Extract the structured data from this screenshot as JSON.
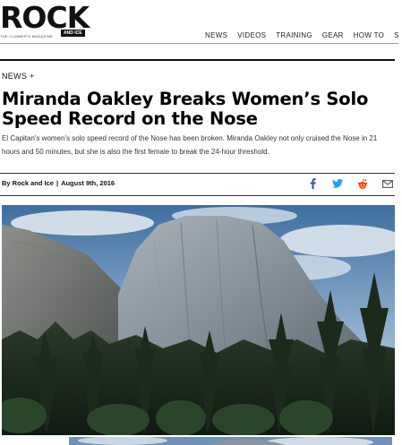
{
  "site": {
    "logo_text": "ROCK",
    "logo_badge": "AND ICE",
    "tagline": "THE CLIMBER'S MAGAZINE",
    "nav": [
      "NEWS",
      "VIDEOS",
      "TRAINING",
      "GEAR",
      "HOW TO",
      "S"
    ]
  },
  "article": {
    "category": "NEWS +",
    "title": "Miranda Oakley Breaks Women’s Solo Speed Record on the Nose",
    "dek": "El Capitan's women's solo speed record of the Nose has been broken. Miranda Oakley not only cruised the Nose in 21 hours and 50 minutes, but she is also the first female to break the 24-hour threshold.",
    "author": "By Rock and Ice",
    "date": "August 9th, 2016",
    "separator": "|"
  },
  "share": {
    "icons": [
      "facebook-icon",
      "twitter-icon",
      "reddit-icon",
      "email-icon"
    ]
  },
  "colors": {
    "facebook": "#3b5998",
    "twitter": "#1da1f2",
    "reddit": "#ff4500",
    "email": "#555555"
  }
}
